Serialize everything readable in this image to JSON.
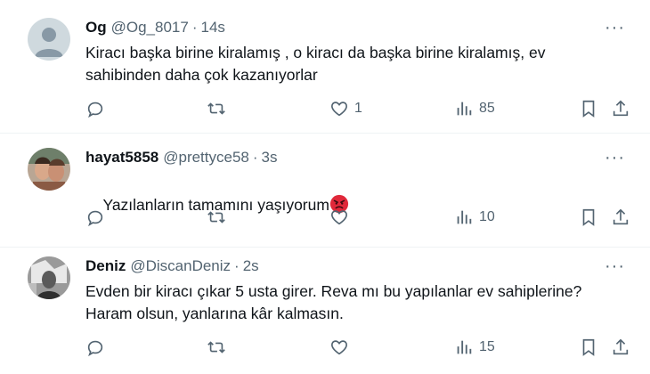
{
  "tweets": [
    {
      "name": "Og",
      "handle": "@Og_8017",
      "dot": "·",
      "time": "14s",
      "text": "Kiracı başka birine kiralamış , o kiracı da başka birine kiralamış, ev sahibinden daha çok kazanıyorlar",
      "reply_count": "",
      "retweet_count": "",
      "like_count": "1",
      "view_count": "85",
      "avatar": "default-avatar",
      "more_label": "···"
    },
    {
      "name": "hayat5858",
      "handle": "@prettyce58",
      "dot": "·",
      "time": "3s",
      "text": "Yazılanların tamamını yaşıyorum",
      "emoji": "angry-face-emoji",
      "reply_count": "",
      "retweet_count": "",
      "like_count": "",
      "view_count": "10",
      "avatar": "photo-avatar",
      "more_label": "···"
    },
    {
      "name": "Deniz",
      "handle": "@DiscanDeniz",
      "dot": "·",
      "time": "2s",
      "text": "Evden bir kiracı çıkar 5 usta girer. Reva mı bu yapılanlar ev sahiplerine? Haram olsun, yanlarına kâr kalmasın.",
      "reply_count": "",
      "retweet_count": "",
      "like_count": "",
      "view_count": "15",
      "avatar": "bw-photo-avatar",
      "more_label": "···"
    }
  ],
  "colors": {
    "text_primary": "#0f1419",
    "text_secondary": "#536471",
    "divider": "#eff3f4",
    "icon": "#536471"
  },
  "icons": [
    "reply-icon",
    "retweet-icon",
    "like-icon",
    "views-icon",
    "bookmark-icon",
    "share-icon",
    "more-icon"
  ]
}
